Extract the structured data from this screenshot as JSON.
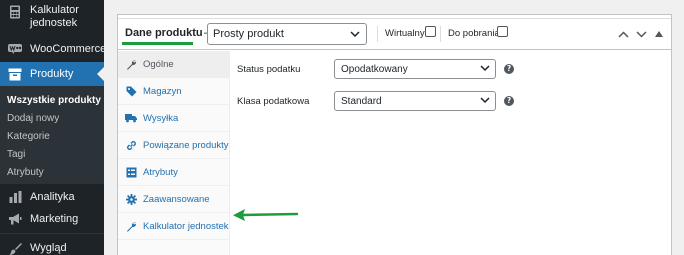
{
  "colors": {
    "accent": "#2271b1",
    "highlight": "#1e9b3e",
    "sidebar_bg": "#1d2327"
  },
  "sidebar": {
    "calculator": {
      "label_line1": "Kalkulator",
      "label_line2": "jednostek",
      "icon": "calculator-icon"
    },
    "woocommerce": {
      "label": "WooCommerce",
      "icon": "woocommerce-icon"
    },
    "products": {
      "label": "Produkty",
      "icon": "archive-icon"
    },
    "submenu": [
      {
        "label": "Wszystkie produkty"
      },
      {
        "label": "Dodaj nowy"
      },
      {
        "label": "Kategorie"
      },
      {
        "label": "Tagi"
      },
      {
        "label": "Atrybuty"
      }
    ],
    "analytics": {
      "label": "Analityka",
      "icon": "bar-chart-icon"
    },
    "marketing": {
      "label": "Marketing",
      "icon": "megaphone-icon"
    },
    "appearance": {
      "label": "Wygląd",
      "icon": "brush-icon"
    }
  },
  "metabox": {
    "title": "Dane produktu",
    "dash": "—",
    "product_type": "Prosty produkt",
    "virtual_label": "Wirtualny:",
    "downloadable_label": "Do pobrania:",
    "virtual_checked": false,
    "downloadable_checked": false
  },
  "tabs": [
    {
      "label": "Ogólne",
      "icon": "wrench-icon"
    },
    {
      "label": "Magazyn",
      "icon": "tag-icon"
    },
    {
      "label": "Wysyłka",
      "icon": "truck-icon"
    },
    {
      "label": "Powiązane produkty",
      "icon": "link-icon"
    },
    {
      "label": "Atrybuty",
      "icon": "list-icon"
    },
    {
      "label": "Zaawansowane",
      "icon": "gear-icon"
    },
    {
      "label": "Kalkulator jednostek",
      "icon": "wrench-icon"
    }
  ],
  "fields": {
    "tax_status": {
      "label": "Status podatku",
      "value": "Opodatkowany"
    },
    "tax_class": {
      "label": "Klasa podatkowa",
      "value": "Standard"
    }
  }
}
